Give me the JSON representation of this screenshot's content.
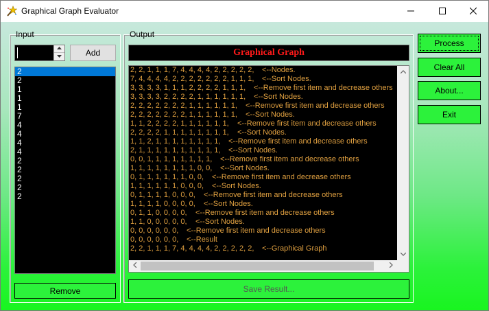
{
  "window": {
    "title": "Graphical Graph Evaluator"
  },
  "input_group": {
    "label": "Input",
    "numeric_value": "",
    "add_label": "Add",
    "remove_label": "Remove",
    "list_items": [
      "2",
      "2",
      "1",
      "1",
      "1",
      "7",
      "4",
      "4",
      "4",
      "4",
      "2",
      "2",
      "2",
      "2",
      "2"
    ],
    "selected_index": 0
  },
  "output_group": {
    "label": "Output",
    "header_title": "Graphical Graph",
    "save_label": "Save Result...",
    "lines": [
      {
        "nodes": "2, 2, 1, 1, 1, 7, 4, 4, 4, 4, 2, 2, 2, 2, 2,",
        "comment": "<--Nodes."
      },
      {
        "nodes": "7, 4, 4, 4, 4, 2, 2, 2, 2, 2, 2, 2, 1, 1, 1,",
        "comment": "<--Sort Nodes."
      },
      {
        "nodes": "3, 3, 3, 3, 1, 1, 1, 2, 2, 2, 2, 1, 1, 1,",
        "comment": "<--Remove first item and decrease others"
      },
      {
        "nodes": "3, 3, 3, 3, 2, 2, 2, 2, 1, 1, 1, 1, 1, 1,",
        "comment": "<--Sort Nodes."
      },
      {
        "nodes": "2, 2, 2, 2, 2, 2, 2, 1, 1, 1, 1, 1, 1,",
        "comment": "<--Remove first item and decrease others"
      },
      {
        "nodes": "2, 2, 2, 2, 2, 2, 2, 1, 1, 1, 1, 1, 1,",
        "comment": "<--Sort Nodes."
      },
      {
        "nodes": "1, 1, 2, 2, 2, 2, 1, 1, 1, 1, 1, 1,",
        "comment": "<--Remove first item and decrease others"
      },
      {
        "nodes": "2, 2, 2, 2, 1, 1, 1, 1, 1, 1, 1, 1,",
        "comment": "<--Sort Nodes."
      },
      {
        "nodes": "1, 1, 2, 1, 1, 1, 1, 1, 1, 1, 1,",
        "comment": "<--Remove first item and decrease others"
      },
      {
        "nodes": "2, 1, 1, 1, 1, 1, 1, 1, 1, 1, 1,",
        "comment": "<--Sort Nodes."
      },
      {
        "nodes": "0, 0, 1, 1, 1, 1, 1, 1, 1, 1,",
        "comment": "<--Remove first item and decrease others"
      },
      {
        "nodes": "1, 1, 1, 1, 1, 1, 1, 1, 0, 0,",
        "comment": "<--Sort Nodes."
      },
      {
        "nodes": "0, 1, 1, 1, 1, 1, 1, 0, 0,",
        "comment": "<--Remove first item and decrease others"
      },
      {
        "nodes": "1, 1, 1, 1, 1, 1, 0, 0, 0,",
        "comment": "<--Sort Nodes."
      },
      {
        "nodes": "0, 1, 1, 1, 1, 0, 0, 0,",
        "comment": "<--Remove first item and decrease others"
      },
      {
        "nodes": "1, 1, 1, 1, 0, 0, 0, 0,",
        "comment": "<--Sort Nodes."
      },
      {
        "nodes": "0, 1, 1, 0, 0, 0, 0,",
        "comment": "<--Remove first item and decrease others"
      },
      {
        "nodes": "1, 1, 0, 0, 0, 0, 0,",
        "comment": "<--Sort Nodes."
      },
      {
        "nodes": "0, 0, 0, 0, 0, 0,",
        "comment": "<--Remove first item and decrease others"
      },
      {
        "nodes": "0, 0, 0, 0, 0, 0,",
        "comment": "<--Result"
      },
      {
        "nodes": "2, 2, 1, 1, 1, 7, 4, 4, 4, 4, 2, 2, 2, 2, 2,",
        "comment": "<--Graphical Graph"
      }
    ]
  },
  "buttons": {
    "process": "Process",
    "clear_all": "Clear All",
    "about": "About...",
    "exit": "Exit"
  },
  "colors": {
    "gradient_top": "#c7e8dc",
    "gradient_bottom": "#18f51f",
    "header_text": "#ff1a1a",
    "output_text": "#e0a040",
    "selection": "#0078d7",
    "button_green": "#2cf23b"
  },
  "icons": {
    "app": "magic-wand-star-icon",
    "minimize": "minimize-icon",
    "maximize": "maximize-icon",
    "close": "close-icon"
  }
}
